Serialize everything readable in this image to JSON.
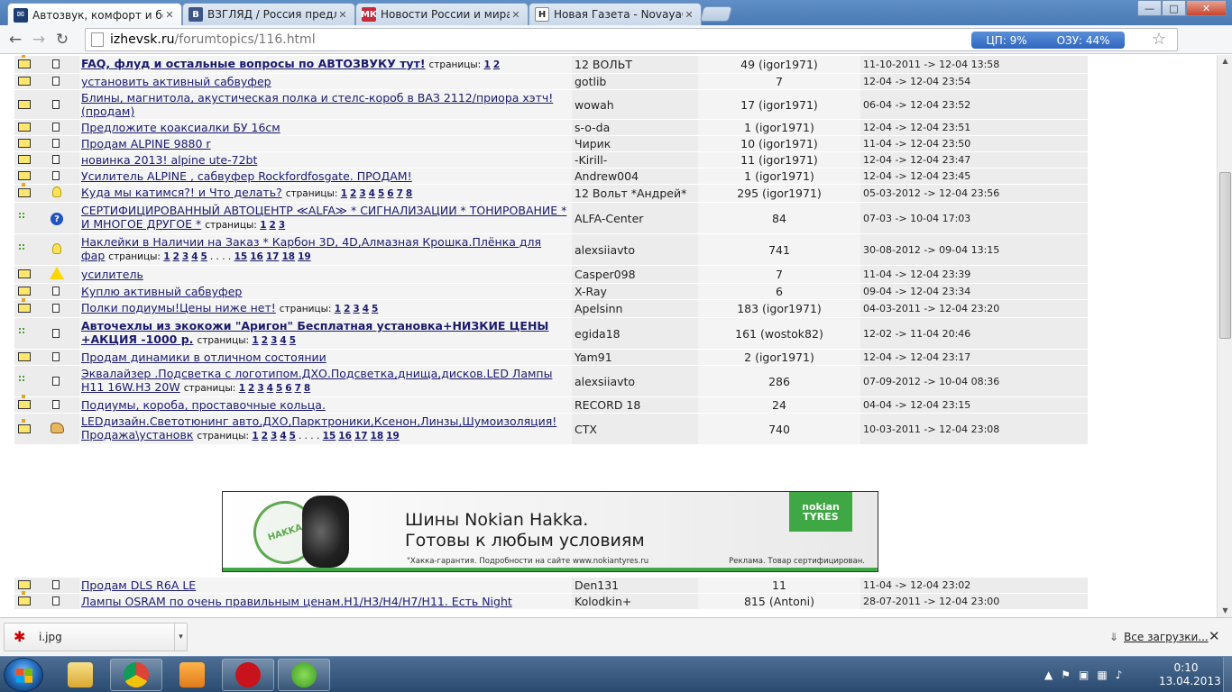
{
  "browser": {
    "tabs": [
      {
        "title": "Автозвук, комфорт и без",
        "favicon": "mail-icon",
        "active": true
      },
      {
        "title": "ВЗГЛЯД / Россия предло",
        "favicon": "vzglyad-icon",
        "active": false
      },
      {
        "title": "Новости России и мира",
        "favicon": "mk-icon",
        "active": false
      },
      {
        "title": "Новая Газета - NovayaGa",
        "favicon": "novayagazeta-icon",
        "active": false
      }
    ],
    "url_host": "izhevsk.ru",
    "url_path": "/forumtopics/116.html",
    "cpu_label": "ЦП: 9%",
    "ram_label": "ОЗУ: 44%",
    "min_label": "—",
    "max_label": "□",
    "close_label": "✕"
  },
  "forum": {
    "topics": [
      {
        "icon_left": "folder-new",
        "icon_status": "doc",
        "title": "FAQ, флуд и остальные вопросы по АВТОЗВУКУ тут!",
        "bold": true,
        "pages": [
          "1",
          "2"
        ],
        "author": "12 ВОЛЬТ",
        "replies": "49 (igor1971)",
        "dates": "11-10-2011 -> 12-04 13:58"
      },
      {
        "icon_left": "folder",
        "icon_status": "doc",
        "title": "установить активный сабвуфер",
        "bold": false,
        "pages": [],
        "author": "gotlib",
        "replies": "7",
        "dates": "12-04 -> 12-04 23:54"
      },
      {
        "icon_left": "folder",
        "icon_status": "doc",
        "title": "Блины, магнитола, акустическая полка и стелс-короб в ВАЗ 2112/приора хэтч! (продам)",
        "bold": false,
        "pages": [],
        "author": "wowah",
        "replies": "17 (igor1971)",
        "dates": "06-04 -> 12-04 23:52"
      },
      {
        "icon_left": "folder",
        "icon_status": "doc",
        "title": "Предложите коаксиалки БУ 16см",
        "bold": false,
        "pages": [],
        "author": "s-o-da",
        "replies": "1 (igor1971)",
        "dates": "12-04 -> 12-04 23:51"
      },
      {
        "icon_left": "folder",
        "icon_status": "doc",
        "title": "Продам ALPINE 9880 r",
        "bold": false,
        "pages": [],
        "author": "Чирик",
        "replies": "10 (igor1971)",
        "dates": "11-04 -> 12-04 23:50"
      },
      {
        "icon_left": "folder",
        "icon_status": "doc",
        "title": "новинка 2013! alpine ute-72bt",
        "bold": false,
        "pages": [],
        "author": "-Kirill-",
        "replies": "11 (igor1971)",
        "dates": "12-04 -> 12-04 23:47"
      },
      {
        "icon_left": "folder",
        "icon_status": "doc",
        "title": "Усилитель ALPINE , сабвуфер Rockfordfosgate. ПРОДАМ!",
        "bold": false,
        "pages": [],
        "author": "Andrew004",
        "replies": "1 (igor1971)",
        "dates": "12-04 -> 12-04 23:45"
      },
      {
        "icon_left": "folder-new",
        "icon_status": "bulb",
        "title": "Куда мы катимся?! и Что делать?",
        "bold": false,
        "pages": [
          "1",
          "2",
          "3",
          "4",
          "5",
          "6",
          "7",
          "8"
        ],
        "author": "12 Вольт *Андрей*",
        "replies": "295 (igor1971)",
        "dates": "05-03-2012 -> 12-04 23:56"
      },
      {
        "icon_left": "plus",
        "icon_status": "question",
        "title": "СЕРТИФИЦИРОВАННЫЙ АВТОЦЕНТР ≪ALFA≫ * СИГНАЛИЗАЦИИ * ТОНИРОВАНИЕ * И МНОГОЕ ДРУГОЕ *",
        "bold": false,
        "pages": [
          "1",
          "2",
          "3"
        ],
        "author": "ALFA-Center",
        "replies": "84",
        "dates": "07-03 -> 10-04 17:03"
      },
      {
        "icon_left": "plus",
        "icon_status": "bulb",
        "title": "Наклейки в Наличии на Заказ * Карбон 3D, 4D,Алмазная Крошка.Плёнка для фар",
        "bold": false,
        "pages": [
          "1",
          "2",
          "3",
          "4",
          "5",
          ". . . .",
          "15",
          "16",
          "17",
          "18",
          "19"
        ],
        "author": "alexsiiavto",
        "replies": "741",
        "dates": "30-08-2012 -> 09-04 13:15"
      },
      {
        "icon_left": "folder",
        "icon_status": "warning",
        "title": "усилитель",
        "bold": false,
        "pages": [],
        "author": "Casper098",
        "replies": "7",
        "dates": "11-04 -> 12-04 23:39"
      },
      {
        "icon_left": "folder",
        "icon_status": "doc",
        "title": "Куплю активный сабвуфер",
        "bold": false,
        "pages": [],
        "author": "X-Ray",
        "replies": "6",
        "dates": "09-04 -> 12-04 23:34"
      },
      {
        "icon_left": "folder-new",
        "icon_status": "doc",
        "title": "Полки подиумы!Цены ниже нет!",
        "bold": false,
        "pages": [
          "1",
          "2",
          "3",
          "4",
          "5"
        ],
        "author": "Apelsinn",
        "replies": "183 (igor1971)",
        "dates": "04-03-2011 -> 12-04 23:20"
      },
      {
        "icon_left": "plus",
        "icon_status": "doc",
        "title": "Авточехлы из экокожи \"Аригон\" Бесплатная установка+НИЗКИЕ ЦЕНЫ +АКЦИЯ -1000 р.",
        "bold": true,
        "pages": [
          "1",
          "2",
          "3",
          "4",
          "5"
        ],
        "author": "egida18",
        "replies": "161 (wostok82)",
        "dates": "12-02 -> 11-04 20:46"
      },
      {
        "icon_left": "folder",
        "icon_status": "doc",
        "title": "Продам динамики в отличном состоянии",
        "bold": false,
        "pages": [],
        "author": "Yam91",
        "replies": "2 (igor1971)",
        "dates": "12-04 -> 12-04 23:17"
      },
      {
        "icon_left": "plus",
        "icon_status": "doc",
        "title": "Эквалайзер .Подсветка с логотипом.ДХО.Подсветка,днища,дисков.LED Лампы H11 16W.H3 20W",
        "bold": false,
        "pages": [
          "1",
          "2",
          "3",
          "4",
          "5",
          "6",
          "7",
          "8"
        ],
        "author": "alexsiiavto",
        "replies": "286",
        "dates": "07-09-2012 -> 10-04 08:36"
      },
      {
        "icon_left": "folder-new",
        "icon_status": "doc",
        "title": "Подиумы, короба, проставочные кольца.",
        "bold": false,
        "pages": [],
        "author": "RECORD 18",
        "replies": "24",
        "dates": "04-04 -> 12-04 23:15"
      },
      {
        "icon_left": "folder-new",
        "icon_status": "hand",
        "title": "LEDдизайн.Светотюнинг авто,ДХО,Парктроники,Ксенон,Линзы,Шумоизоляция! Продажа\\установк",
        "bold": false,
        "pages": [
          "1",
          "2",
          "3",
          "4",
          "5",
          ". . . .",
          "15",
          "16",
          "17",
          "18",
          "19"
        ],
        "author": "СТХ",
        "replies": "740",
        "dates": "10-03-2011 -> 12-04 23:08"
      }
    ],
    "topics_after_banner": [
      {
        "icon_left": "folder",
        "icon_status": "doc",
        "title": "Продам DLS R6A LE",
        "bold": false,
        "pages": [],
        "author": "Den131",
        "replies": "11",
        "dates": "11-04 -> 12-04 23:02"
      },
      {
        "icon_left": "folder-new",
        "icon_status": "doc",
        "title": "Лампы OSRAM по очень правильным ценам.H1/H3/H4/H7/H11. Есть Night",
        "bold": false,
        "pages": [],
        "author": "Kolodkin+",
        "replies": "815 (Antoni)",
        "dates": "28-07-2011 -> 12-04 23:00"
      }
    ],
    "pages_label": "страницы:"
  },
  "banner": {
    "headline1": "Шины Nokian Hakka.",
    "headline2": "Готовы к любым условиям",
    "footnote": "\"Хакка-гарантия. Подробности на сайте www.nokiantyres.ru",
    "adnote": "Реклама. Товар сертифицирован.",
    "logo_line1": "nokian",
    "logo_line2": "TYRES",
    "seal_text": "HAKKA GUARANTEE"
  },
  "downloads": {
    "file_name": "i.jpg",
    "all_label": "Все загрузки...",
    "close_label": "✕"
  },
  "taskbar": {
    "time": "0:10",
    "date": "13.04.2013"
  },
  "colors": {
    "link": "#1b1b6f",
    "row_bg": "#ececec",
    "cpu_widget": "#2f67bf",
    "nokian_green": "#3fa744"
  }
}
